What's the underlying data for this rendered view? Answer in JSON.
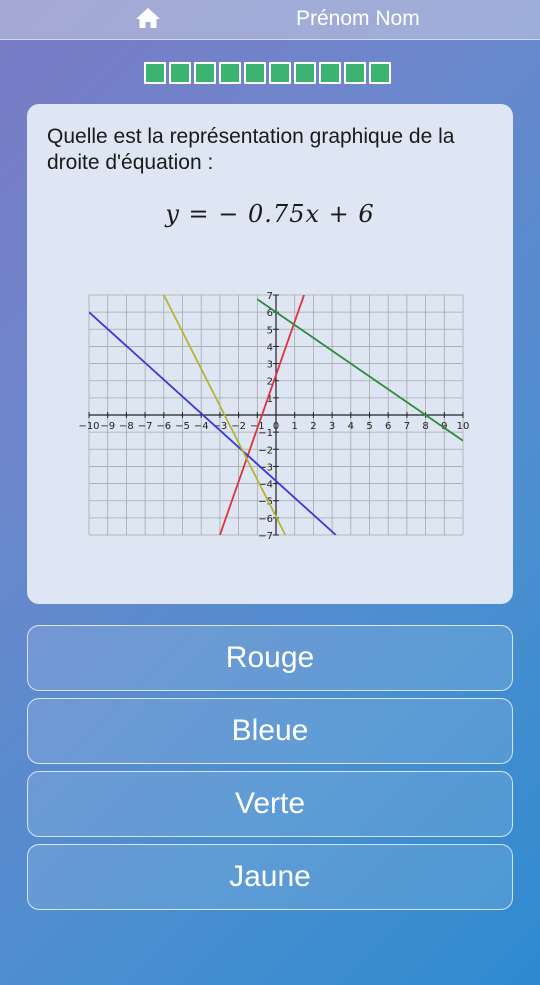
{
  "header": {
    "user_name": "Prénom Nom",
    "home_icon": "home-icon"
  },
  "progress": {
    "total_steps": 10,
    "completed_steps": 10,
    "color": "#3cb371"
  },
  "question": {
    "text": "Quelle est la représentation graphique de la droite d'équation :",
    "equation": "y = − 0.75x + 6"
  },
  "chart_data": {
    "type": "line",
    "xlim": [
      -10,
      10
    ],
    "ylim": [
      -7,
      7
    ],
    "x_ticks": [
      "−10",
      "−9",
      "−8",
      "−7",
      "−6",
      "−5",
      "−4",
      "−3",
      "−2",
      "−1",
      "0",
      "1",
      "2",
      "3",
      "4",
      "5",
      "6",
      "7",
      "8",
      "9",
      "10"
    ],
    "y_ticks": [
      "−7",
      "−6",
      "−5",
      "−4",
      "−3",
      "−2",
      "−1",
      "0",
      "1",
      "2",
      "3",
      "4",
      "5",
      "6",
      "7"
    ],
    "grid": true,
    "series": [
      {
        "color": "#e0323c",
        "x": [
          -3,
          1.5
        ],
        "y": [
          -7,
          7
        ]
      },
      {
        "color": "#3a3ad8",
        "x": [
          -10,
          3.2
        ],
        "y": [
          6,
          -7
        ]
      },
      {
        "color": "#2e8b3a",
        "x": [
          -1,
          10
        ],
        "y": [
          6.75,
          -1.5
        ]
      },
      {
        "color": "#b5b535",
        "x": [
          -6,
          0.5
        ],
        "y": [
          7,
          -7
        ]
      }
    ]
  },
  "answers": [
    {
      "label": "Rouge"
    },
    {
      "label": "Bleue"
    },
    {
      "label": "Verte"
    },
    {
      "label": "Jaune"
    }
  ]
}
